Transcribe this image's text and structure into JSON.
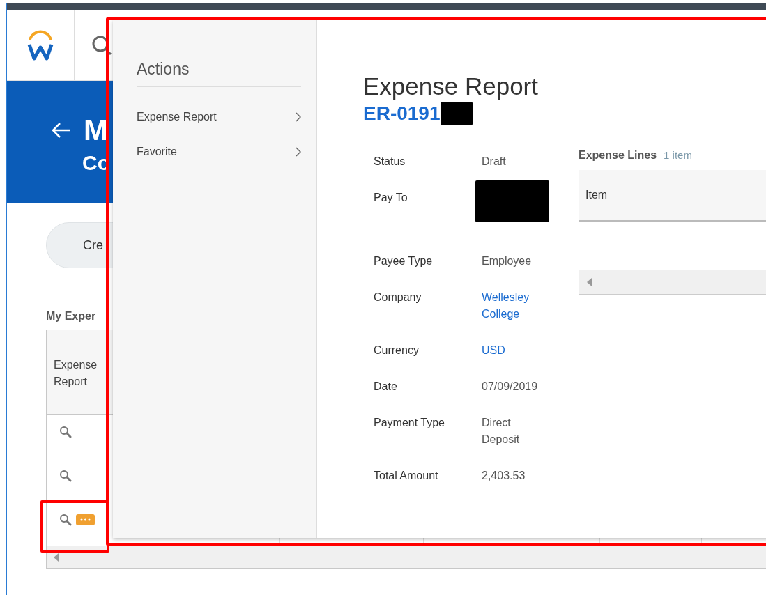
{
  "page": {
    "title": "M",
    "subtitle": "Co",
    "create_button": "Cre",
    "section_title": "My Exper",
    "table": {
      "columns": [
        "Expense Report"
      ],
      "rows": [
        {
          "related_actions": false
        },
        {
          "related_actions": false
        },
        {
          "related_actions": true
        }
      ]
    }
  },
  "popup": {
    "actions_title": "Actions",
    "actions": [
      {
        "label": "Expense Report"
      },
      {
        "label": "Favorite"
      }
    ],
    "title": "Expense Report",
    "id": "ER-0191",
    "fields": [
      {
        "label": "Status",
        "value": "Draft",
        "kind": "text"
      },
      {
        "label": "Pay To",
        "kind": "redacted"
      },
      {
        "label": "Payee Type",
        "value": "Employee",
        "kind": "text"
      },
      {
        "label": "Company",
        "value": "Wellesley College",
        "kind": "link"
      },
      {
        "label": "Currency",
        "value": "USD",
        "kind": "link"
      },
      {
        "label": "Date",
        "value": "07/09/2019",
        "kind": "text"
      },
      {
        "label": "Payment Type",
        "value": "Direct Deposit",
        "kind": "text"
      },
      {
        "label": "Total Amount",
        "value": "2,403.53",
        "kind": "text"
      }
    ],
    "lines": {
      "title": "Expense Lines",
      "count": "1 item",
      "columns": [
        "Item"
      ]
    }
  }
}
